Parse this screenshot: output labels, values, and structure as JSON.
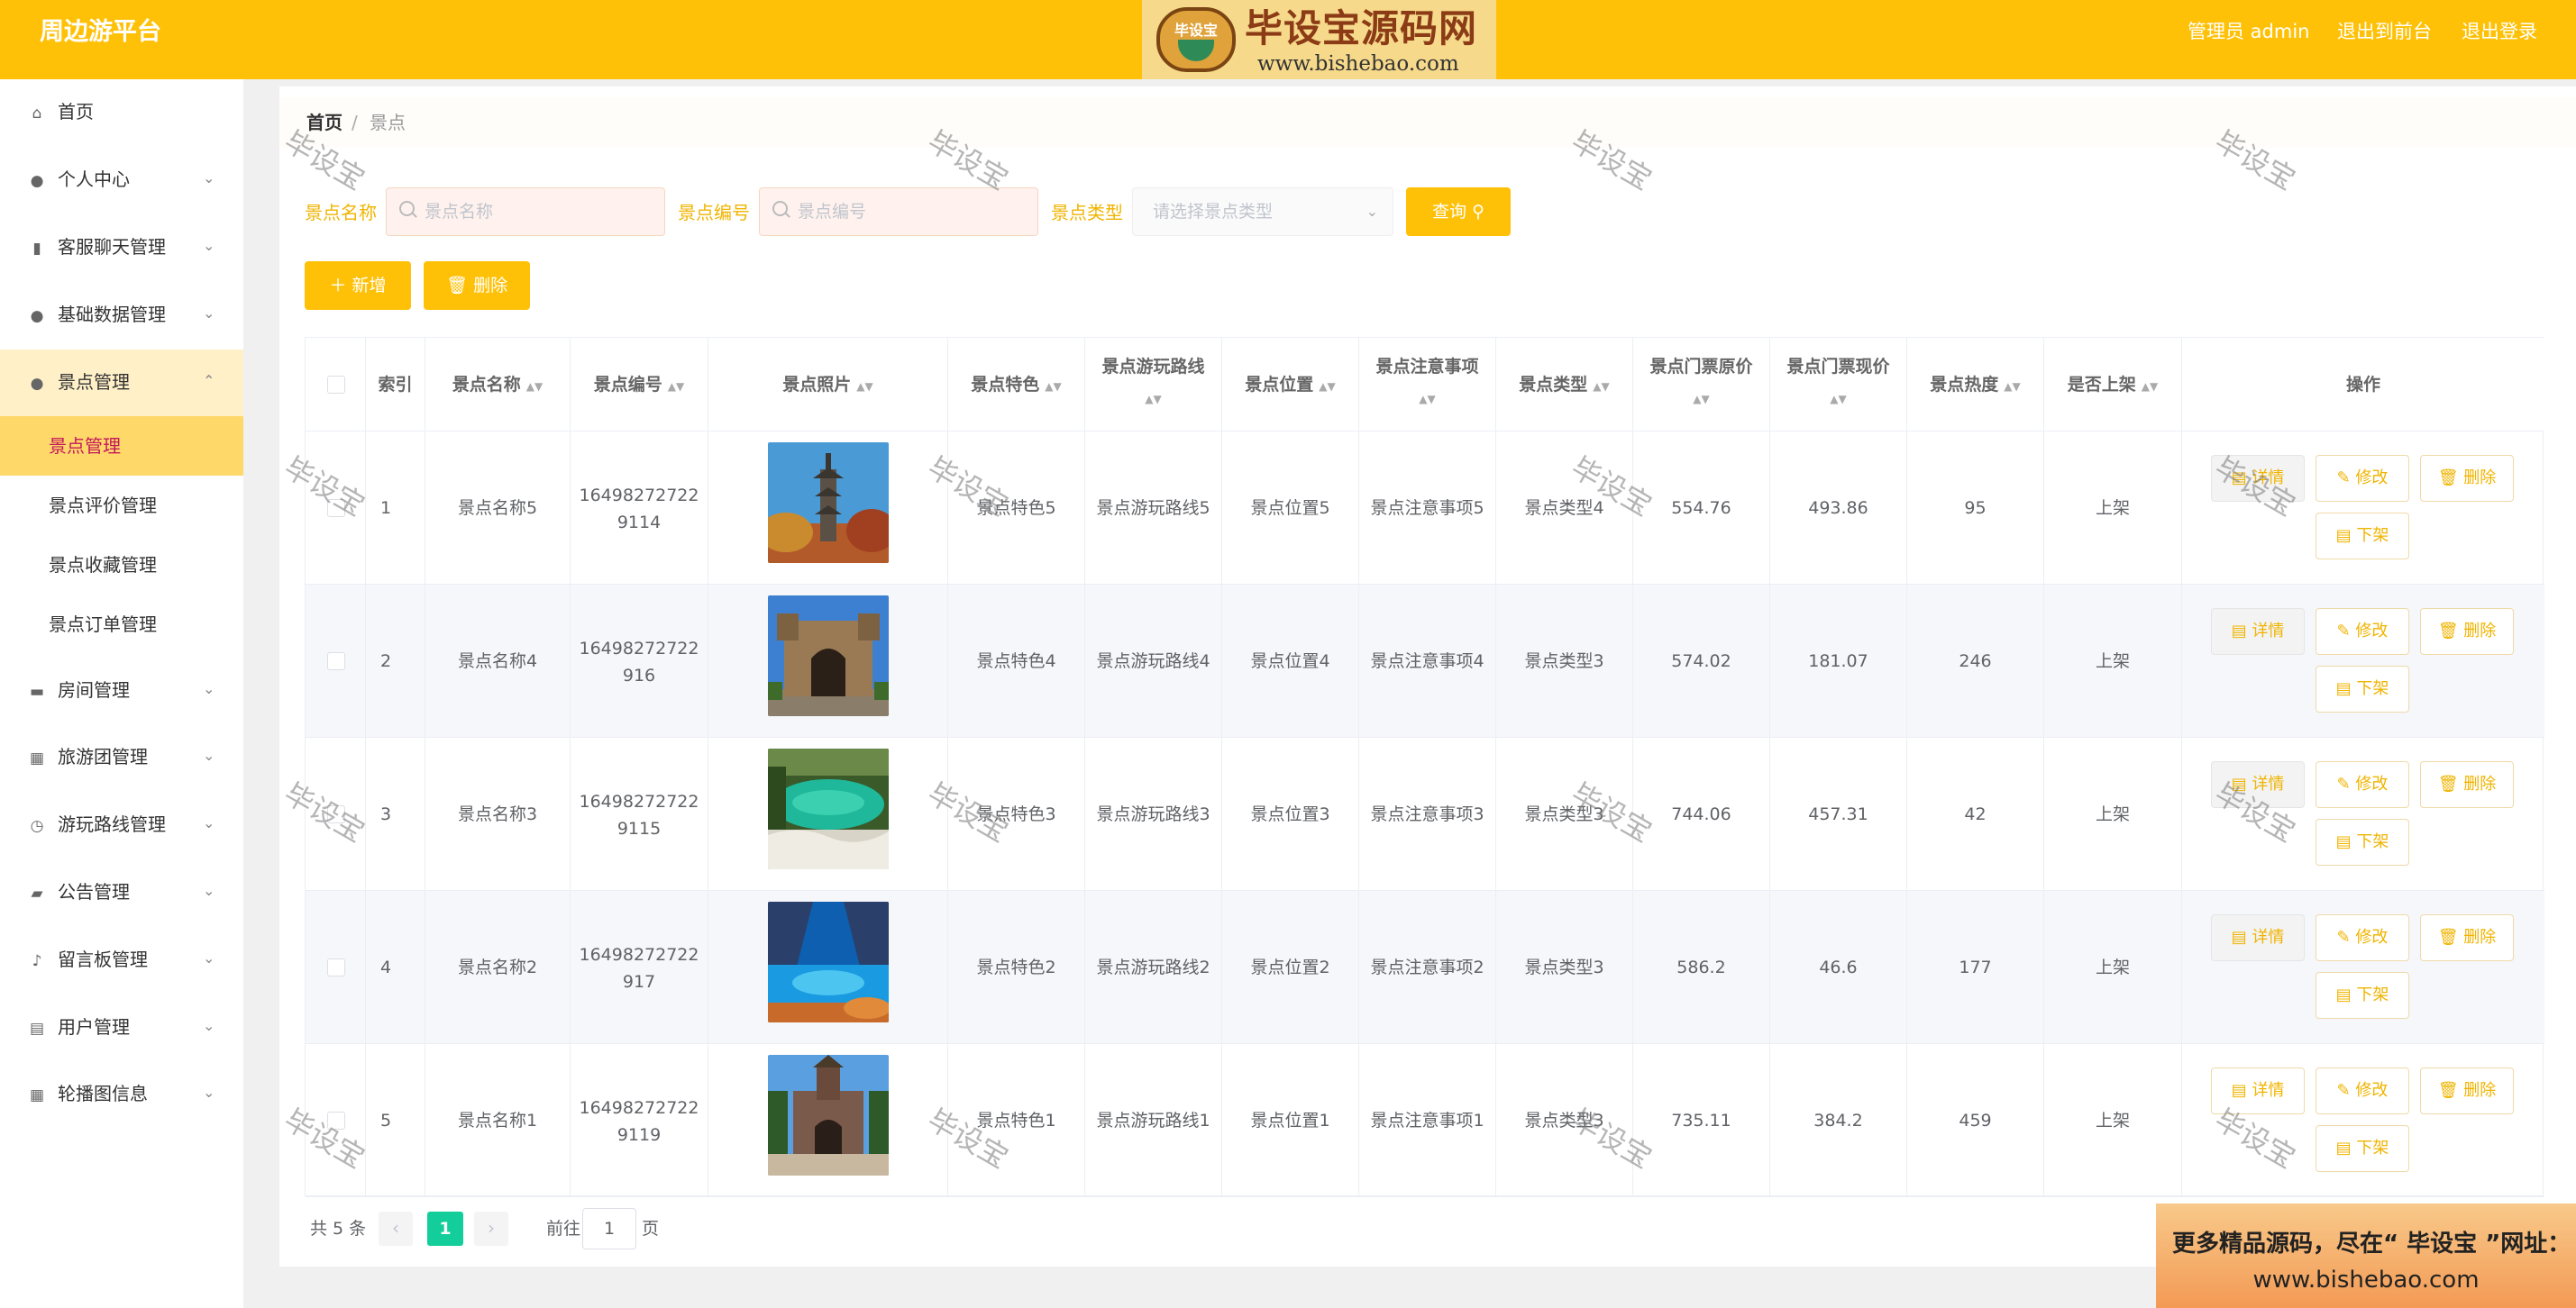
{
  "app": {
    "title": "周边游平台",
    "user_label": "管理员 admin",
    "back_to_front": "退出到前台",
    "logout": "退出登录"
  },
  "watermark_logo": {
    "badge_text": "毕设宝",
    "title": "毕设宝源码网",
    "url": "www.bishebao.com"
  },
  "sidebar": {
    "items": [
      {
        "label": "首页",
        "icon": "home-icon"
      },
      {
        "label": "个人中心",
        "icon": "user-icon"
      },
      {
        "label": "客服聊天管理",
        "icon": "bar-chart-icon"
      },
      {
        "label": "基础数据管理",
        "icon": "user-icon"
      },
      {
        "label": "景点管理",
        "icon": "user-icon"
      },
      {
        "label": "房间管理",
        "icon": "chat-icon"
      },
      {
        "label": "旅游团管理",
        "icon": "grid-icon"
      },
      {
        "label": "游玩路线管理",
        "icon": "clock-icon"
      },
      {
        "label": "公告管理",
        "icon": "briefcase-icon"
      },
      {
        "label": "留言板管理",
        "icon": "mic-icon"
      },
      {
        "label": "用户管理",
        "icon": "clipboard-icon"
      },
      {
        "label": "轮播图信息",
        "icon": "grid-icon"
      }
    ],
    "sub_items": [
      "景点管理",
      "景点评价管理",
      "景点收藏管理",
      "景点订单管理"
    ]
  },
  "breadcrumb": {
    "home": "首页",
    "separator": "/",
    "current": "景点"
  },
  "filters": {
    "name_label": "景点名称",
    "name_placeholder": "景点名称",
    "code_label": "景点编号",
    "code_placeholder": "景点编号",
    "type_label": "景点类型",
    "type_placeholder": "请选择景点类型",
    "query_button": "查询"
  },
  "toolbar": {
    "add": "新增",
    "delete": "删除"
  },
  "table": {
    "headers": {
      "index": "索引",
      "name": "景点名称",
      "code": "景点编号",
      "photo": "景点照片",
      "feature": "景点特色",
      "route": "景点游玩路线",
      "location": "景点位置",
      "notice": "景点注意事项",
      "type": "景点类型",
      "orig_price": "景点门票原价",
      "cur_price": "景点门票现价",
      "hot": "景点热度",
      "listed": "是否上架",
      "ops": "操作"
    },
    "actions": {
      "detail": "详情",
      "edit": "修改",
      "delete": "删除",
      "off": "下架"
    },
    "rows": [
      {
        "index": "1",
        "name": "景点名称5",
        "code1": "16498272722",
        "code2": "9114",
        "photo": "pagoda",
        "feature": "景点特色5",
        "route": "景点游玩路线5",
        "location": "景点位置5",
        "notice": "景点注意事项5",
        "type": "景点类型4",
        "orig_price": "554.76",
        "cur_price": "493.86",
        "hot": "95",
        "listed": "上架"
      },
      {
        "index": "2",
        "name": "景点名称4",
        "code1": "16498272722",
        "code2": "916",
        "photo": "gate",
        "feature": "景点特色4",
        "route": "景点游玩路线4",
        "location": "景点位置4",
        "notice": "景点注意事项4",
        "type": "景点类型3",
        "orig_price": "574.02",
        "cur_price": "181.07",
        "hot": "246",
        "listed": "上架"
      },
      {
        "index": "3",
        "name": "景点名称3",
        "code1": "16498272722",
        "code2": "9115",
        "photo": "lake",
        "feature": "景点特色3",
        "route": "景点游玩路线3",
        "location": "景点位置3",
        "notice": "景点注意事项3",
        "type": "景点类型3",
        "orig_price": "744.06",
        "cur_price": "457.31",
        "hot": "42",
        "listed": "上架"
      },
      {
        "index": "4",
        "name": "景点名称2",
        "code1": "16498272722",
        "code2": "917",
        "photo": "valley",
        "feature": "景点特色2",
        "route": "景点游玩路线2",
        "location": "景点位置2",
        "notice": "景点注意事项2",
        "type": "景点类型3",
        "orig_price": "586.2",
        "cur_price": "46.6",
        "hot": "177",
        "listed": "上架"
      },
      {
        "index": "5",
        "name": "景点名称1",
        "code1": "16498272722",
        "code2": "9119",
        "photo": "castle",
        "feature": "景点特色1",
        "route": "景点游玩路线1",
        "location": "景点位置1",
        "notice": "景点注意事项1",
        "type": "景点类型3",
        "orig_price": "735.11",
        "cur_price": "384.2",
        "hot": "459",
        "listed": "上架"
      }
    ]
  },
  "pagination": {
    "total": "共 5 条",
    "current": "1",
    "goto": "前往",
    "page_input": "1",
    "page_suffix": "页"
  },
  "watermark_text": "毕设宝",
  "ad": {
    "line1": "更多精品源码，尽在“ 毕设宝 ”网址：",
    "line2": "www.bishebao.com"
  },
  "colors": {
    "accent": "#ffc107",
    "active_sub": "#ffd86a",
    "page_current": "#13ce9a"
  }
}
